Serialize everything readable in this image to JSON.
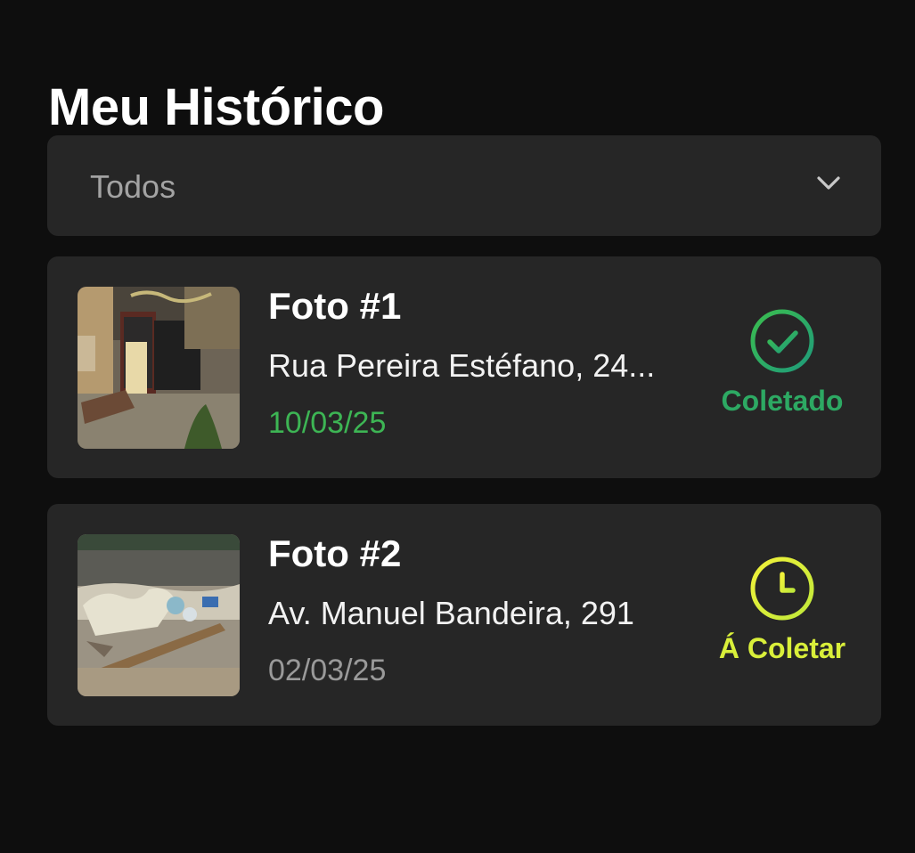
{
  "page": {
    "title": "Meu Histórico"
  },
  "filter": {
    "selected": "Todos",
    "icon": "chevron-down-icon"
  },
  "history": [
    {
      "title": "Foto #1",
      "address": "Rua Pereira Estéfano, 24...",
      "date": "10/03/25",
      "status": "Coletado",
      "status_icon": "check-circle-icon",
      "status_color": "#2da963",
      "date_color": "#3db554"
    },
    {
      "title": "Foto #2",
      "address": "Av. Manuel Bandeira, 291",
      "date": "02/03/25",
      "status": "Á Coletar",
      "status_icon": "clock-icon",
      "status_color": "#d9ef3a",
      "date_color": "#9a9a9a"
    }
  ],
  "colors": {
    "background": "#0e0e0e",
    "card": "#262626",
    "accent_green": "#2da963",
    "accent_yellow": "#d9ef3a"
  }
}
